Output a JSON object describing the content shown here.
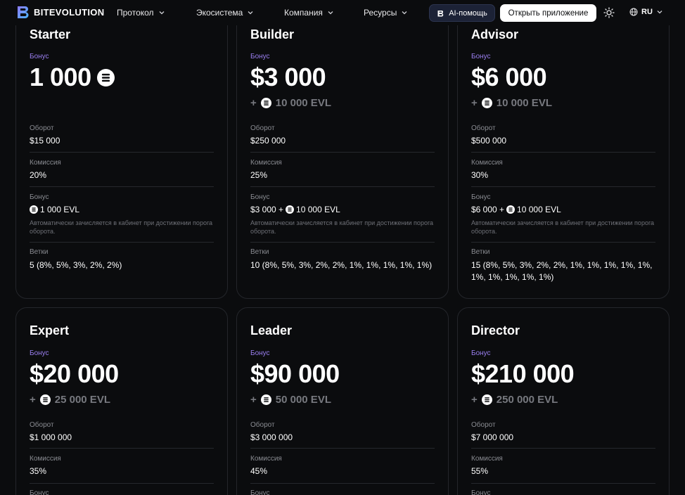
{
  "header": {
    "logo_text": "BITEVOLUTION",
    "nav": [
      {
        "label": "Протокол"
      },
      {
        "label": "Экосистема"
      },
      {
        "label": "Компания"
      },
      {
        "label": "Ресурсы"
      }
    ],
    "ai_button": "AI-помощь",
    "open_app_button": "Открыть приложение",
    "language": "RU"
  },
  "icons": {
    "logo": "bitevolution-logo-icon",
    "chevron": "chevron-down-icon",
    "theme": "sun-icon",
    "language": "globe-icon",
    "coin": "evl-coin-icon"
  },
  "colors": {
    "background": "#0b0c0e",
    "accent_purple": "#9a7ff0",
    "muted_text": "#77797f",
    "card_border": "#24262b"
  },
  "labels": {
    "bonus": "Бонус",
    "turnover": "Оборот",
    "commission": "Комиссия",
    "bonus_stat": "Бонус",
    "branches": "Ветки",
    "auto_note": "Автоматически зачисляется в кабинет при достижении порога оборота."
  },
  "cards": [
    {
      "title": "Starter",
      "price": "1 000",
      "extra": "",
      "turnover": "$15 000",
      "commission": "20%",
      "bonus_value_pre": "",
      "bonus_value_post": "1 000 EVL",
      "branches": "5 (8%, 5%, 3%, 2%, 2%)"
    },
    {
      "title": "Builder",
      "price": "$3 000",
      "extra_prefix": "+",
      "extra": "10 000 EVL",
      "turnover": "$250 000",
      "commission": "25%",
      "bonus_value_pre": "$3 000 +",
      "bonus_value_post": "10 000 EVL",
      "branches": "10 (8%, 5%, 3%, 2%, 2%, 1%, 1%, 1%, 1%, 1%)"
    },
    {
      "title": "Advisor",
      "price": "$6 000",
      "extra_prefix": "+",
      "extra": "10 000 EVL",
      "turnover": "$500 000",
      "commission": "30%",
      "bonus_value_pre": "$6 000 +",
      "bonus_value_post": "10 000 EVL",
      "branches": "15 (8%, 5%, 3%, 2%, 2%, 1%, 1%, 1%, 1%, 1%, 1%, 1%, 1%, 1%, 1%)"
    },
    {
      "title": "Expert",
      "price": "$20 000",
      "extra_prefix": "+",
      "extra": "25 000 EVL",
      "turnover": "$1 000 000",
      "commission": "35%",
      "next_label": "Бонус"
    },
    {
      "title": "Leader",
      "price": "$90 000",
      "extra_prefix": "+",
      "extra": "50 000 EVL",
      "turnover": "$3 000 000",
      "commission": "45%",
      "next_label": "Бонус"
    },
    {
      "title": "Director",
      "price": "$210 000",
      "extra_prefix": "+",
      "extra": "250 000 EVL",
      "turnover": "$7 000 000",
      "commission": "55%",
      "next_label": "Бонус"
    }
  ]
}
